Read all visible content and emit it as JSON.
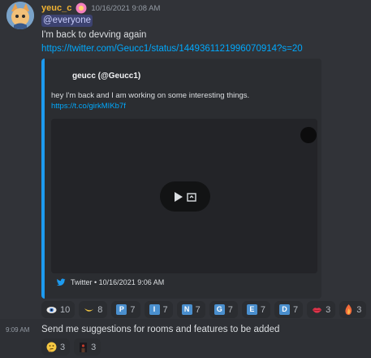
{
  "message": {
    "username": "yeuc_c",
    "timestamp": "10/16/2021 9:08 AM",
    "mention": "@everyone",
    "text": "I'm back to devving again",
    "link": "https://twitter.com/Geucc1/status/1449361121996070914?s=20",
    "colors": {
      "username": "#f0b232",
      "link": "#00a8fc",
      "embed_border": "#1d9bf0"
    }
  },
  "embed": {
    "author": "geucc (@Geucc1)",
    "description": "hey I'm back and I am working on some interesting things.",
    "description_link": "https://t.co/girkMIKb7f",
    "footer": "Twitter • 10/16/2021 9:06 AM"
  },
  "reactions": [
    {
      "icon": "eye-icon",
      "count": "10"
    },
    {
      "icon": "banana-icon",
      "count": "8"
    },
    {
      "letter": "P",
      "count": "7"
    },
    {
      "letter": "I",
      "count": "7"
    },
    {
      "letter": "N",
      "count": "7"
    },
    {
      "letter": "G",
      "count": "7"
    },
    {
      "letter": "E",
      "count": "7"
    },
    {
      "letter": "D",
      "count": "7"
    },
    {
      "icon": "lips-icon",
      "count": "3"
    },
    {
      "icon": "flame-icon",
      "count": "3"
    }
  ],
  "message2": {
    "time": "9:09 AM",
    "text": "Send me suggestions for rooms and features to be added",
    "reactions": [
      {
        "icon": "thinking-face-icon",
        "count": "3"
      },
      {
        "icon": "dark-figure-icon",
        "count": "3"
      }
    ]
  }
}
